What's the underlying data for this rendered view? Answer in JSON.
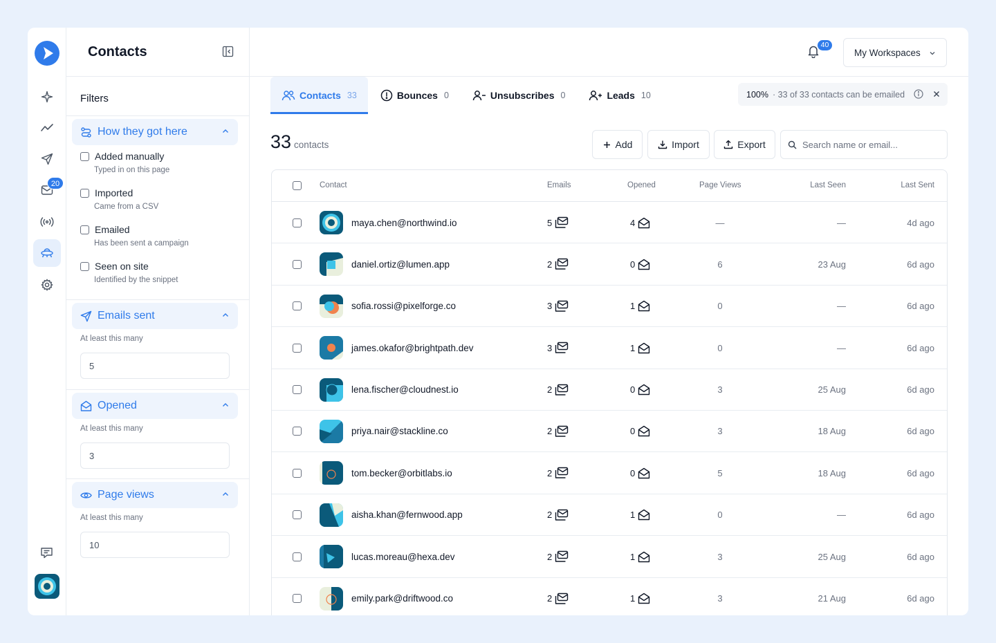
{
  "rail": {
    "items": [
      "sparkle-icon",
      "trend-icon",
      "send-icon",
      "inbox-icon",
      "broadcast-icon",
      "contacts-icon",
      "settings-icon"
    ],
    "inbox_badge": "20",
    "bottom": [
      "feedback-icon"
    ]
  },
  "sidebar": {
    "title": "Contacts",
    "filters_label": "Filters",
    "sections": {
      "how": {
        "label": "How they got here",
        "options": [
          {
            "label": "Added manually",
            "sub": "Typed in on this page"
          },
          {
            "label": "Imported",
            "sub": "Came from a CSV"
          },
          {
            "label": "Emailed",
            "sub": "Has been sent a campaign"
          },
          {
            "label": "Seen on site",
            "sub": "Identified by the snippet"
          }
        ]
      },
      "emails_sent": {
        "label": "Emails sent",
        "hint": "At least this many",
        "value": "5"
      },
      "opened": {
        "label": "Opened",
        "hint": "At least this many",
        "value": "3"
      },
      "page_views": {
        "label": "Page views",
        "hint": "At least this many",
        "value": "10"
      }
    }
  },
  "topbar": {
    "notifications": "40",
    "workspace": "My Workspaces"
  },
  "tabs": [
    {
      "label": "Contacts",
      "count": "33"
    },
    {
      "label": "Bounces",
      "count": "0"
    },
    {
      "label": "Unsubscribes",
      "count": "0"
    },
    {
      "label": "Leads",
      "count": "10"
    }
  ],
  "emailable": {
    "percent": "100%",
    "text": "· 33 of 33 contacts can be emailed"
  },
  "summary": {
    "count": "33",
    "label": "contacts"
  },
  "actions": {
    "add": "Add",
    "import": "Import",
    "export": "Export",
    "search_placeholder": "Search name or email..."
  },
  "table": {
    "headers": {
      "contact": "Contact",
      "emails": "Emails",
      "opened": "Opened",
      "page_views": "Page Views",
      "last_seen": "Last Seen",
      "last_sent": "Last Sent"
    },
    "rows": [
      {
        "email": "maya.chen@northwind.io",
        "emails": "5",
        "opened": "4",
        "views": "—",
        "seen": "—",
        "sent": "4d ago"
      },
      {
        "email": "daniel.ortiz@lumen.app",
        "emails": "2",
        "opened": "0",
        "views": "6",
        "seen": "23 Aug",
        "sent": "6d ago"
      },
      {
        "email": "sofia.rossi@pixelforge.co",
        "emails": "3",
        "opened": "1",
        "views": "0",
        "seen": "—",
        "sent": "6d ago"
      },
      {
        "email": "james.okafor@brightpath.dev",
        "emails": "3",
        "opened": "1",
        "views": "0",
        "seen": "—",
        "sent": "6d ago"
      },
      {
        "email": "lena.fischer@cloudnest.io",
        "emails": "2",
        "opened": "0",
        "views": "3",
        "seen": "25 Aug",
        "sent": "6d ago"
      },
      {
        "email": "priya.nair@stackline.co",
        "emails": "2",
        "opened": "0",
        "views": "3",
        "seen": "18 Aug",
        "sent": "6d ago"
      },
      {
        "email": "tom.becker@orbitlabs.io",
        "emails": "2",
        "opened": "0",
        "views": "5",
        "seen": "18 Aug",
        "sent": "6d ago"
      },
      {
        "email": "aisha.khan@fernwood.app",
        "emails": "2",
        "opened": "1",
        "views": "0",
        "seen": "—",
        "sent": "6d ago"
      },
      {
        "email": "lucas.moreau@hexa.dev",
        "emails": "2",
        "opened": "1",
        "views": "3",
        "seen": "25 Aug",
        "sent": "6d ago"
      },
      {
        "email": "emily.park@driftwood.co",
        "emails": "2",
        "opened": "1",
        "views": "3",
        "seen": "21 Aug",
        "sent": "6d ago"
      }
    ]
  },
  "colors": {
    "accent": "#2f7bea",
    "avatar_dark": "#0b5a7a",
    "avatar_light": "#e9efdd",
    "avatar_orange": "#f0834d",
    "avatar_cyan": "#3ec3e8"
  }
}
